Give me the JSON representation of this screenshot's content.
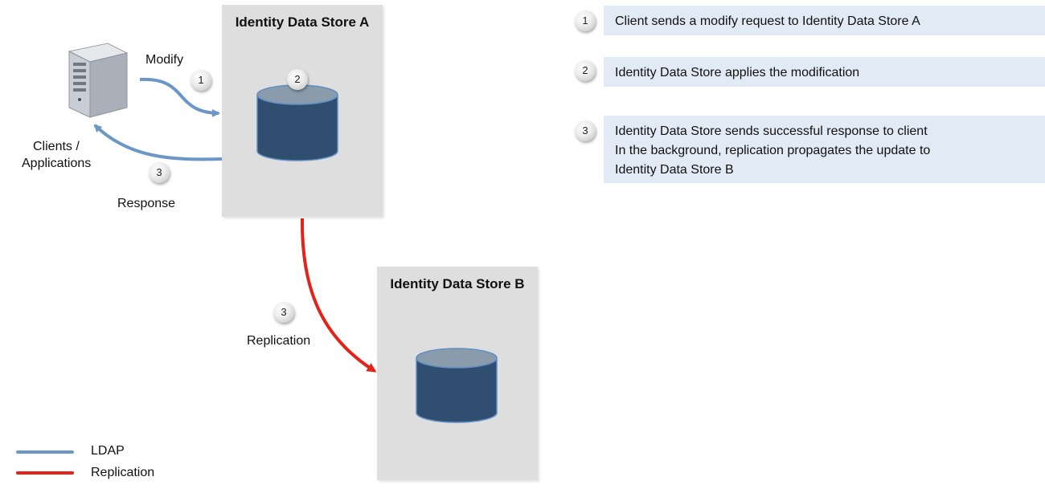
{
  "client": {
    "label_line1": "Clients /",
    "label_line2": "Applications"
  },
  "store_a": {
    "title": "Identity Data Store A"
  },
  "store_b": {
    "title": "Identity Data Store B"
  },
  "arrows": {
    "modify": {
      "label": "Modify",
      "step": "1"
    },
    "response": {
      "label": "Response",
      "step": "3"
    },
    "replication": {
      "label": "Replication",
      "step": "3"
    },
    "store_a_step": "2"
  },
  "steps": [
    {
      "number": "1",
      "lines": [
        "Client sends a modify request to Identity Data Store A"
      ]
    },
    {
      "number": "2",
      "lines": [
        "Identity Data Store applies the modification"
      ]
    },
    {
      "number": "3",
      "lines": [
        "Identity Data Store sends successful response to client",
        "In the background, replication propagates the update to",
        "Identity Data Store B"
      ]
    }
  ],
  "legend": [
    {
      "label": "LDAP",
      "color": "#6a97c6"
    },
    {
      "label": "Replication",
      "color": "#e2231a"
    }
  ],
  "colors": {
    "ldap": "#6a97c6",
    "replication": "#e2231a",
    "database": "#2f4e70",
    "database_top": "#8a9bab",
    "store_box": "#dedede",
    "step_box": "#e2ebf5"
  }
}
